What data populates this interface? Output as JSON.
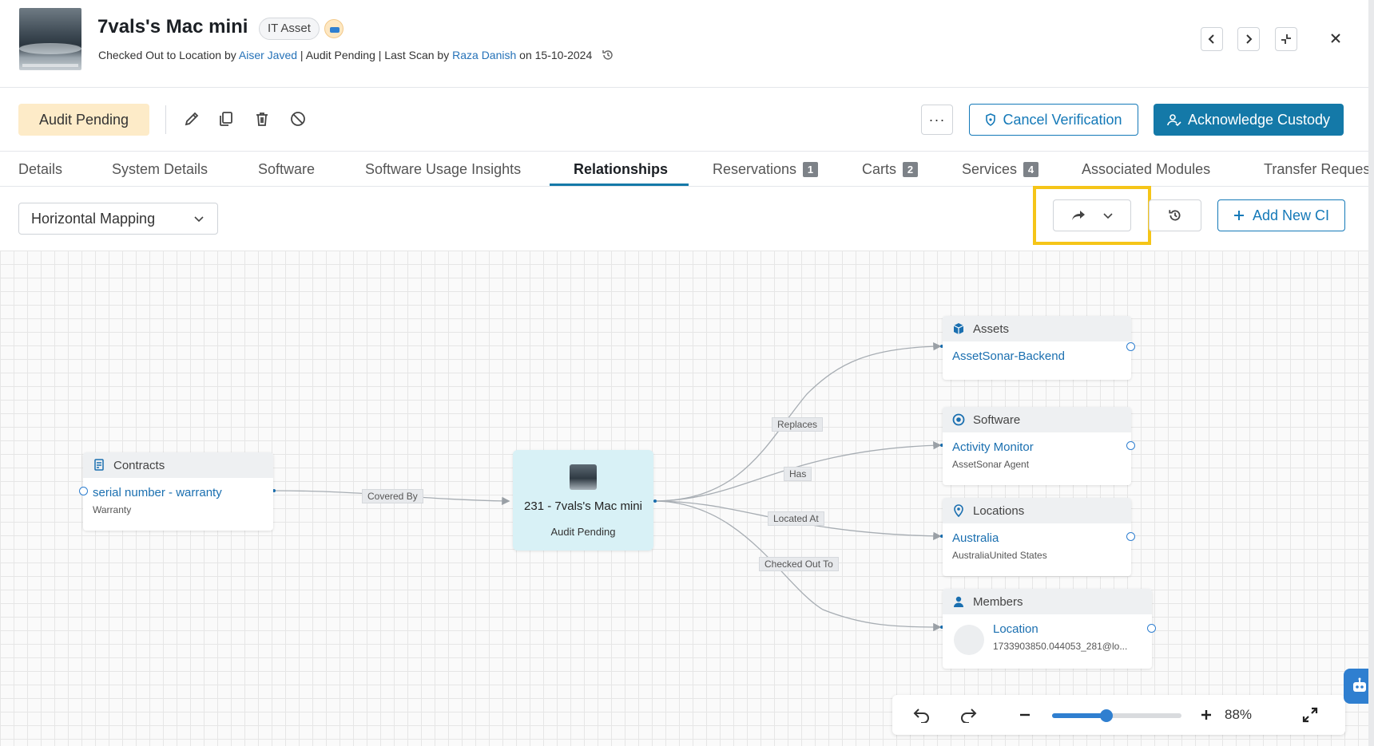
{
  "header": {
    "title": "7vals's Mac mini",
    "type_badge": "IT Asset",
    "sub_prefix": "Checked Out to Location by ",
    "sub_user1": "Aiser Javed",
    "sub_mid": " | Audit Pending | Last Scan by ",
    "sub_user2": "Raza Danish",
    "sub_suffix": " on 15-10-2024"
  },
  "toolbar": {
    "status": "Audit Pending",
    "more_label": "···",
    "cancel_label": "Cancel Verification",
    "ack_label": "Acknowledge Custody"
  },
  "tabs": [
    {
      "label": "Details"
    },
    {
      "label": "System Details"
    },
    {
      "label": "Software"
    },
    {
      "label": "Software Usage Insights"
    },
    {
      "label": "Relationships",
      "active": true
    },
    {
      "label": "Reservations",
      "count": "1"
    },
    {
      "label": "Carts",
      "count": "2"
    },
    {
      "label": "Services",
      "count": "4"
    },
    {
      "label": "Associated Modules"
    },
    {
      "label": "Transfer Reques"
    }
  ],
  "controls": {
    "mapping_value": "Horizontal Mapping",
    "add_label": "Add New CI"
  },
  "graph": {
    "center": {
      "title": "231 - 7vals's Mac mini",
      "status": "Audit Pending"
    },
    "contracts": {
      "header": "Contracts",
      "link": "serial number - warranty",
      "sub": "Warranty"
    },
    "assets": {
      "header": "Assets",
      "link": "AssetSonar-Backend"
    },
    "software": {
      "header": "Software",
      "link": "Activity Monitor",
      "sub": "AssetSonar Agent"
    },
    "locations": {
      "header": "Locations",
      "link": "Australia",
      "sub": "AustraliaUnited States"
    },
    "members": {
      "header": "Members",
      "link": "Location",
      "sub": "1733903850.044053_281@lo..."
    },
    "edge_labels": {
      "covered_by": "Covered By",
      "replaces": "Replaces",
      "has": "Has",
      "located_at": "Located At",
      "checked_out_to": "Checked Out To"
    }
  },
  "zoom": {
    "level_label": "88%",
    "level": 0.42
  },
  "colors": {
    "accent": "#1479a8",
    "link": "#1a6fb0",
    "audit_pill": "#fdebc8",
    "highlight": "#f5c518",
    "center_node": "#d8f1f6"
  }
}
